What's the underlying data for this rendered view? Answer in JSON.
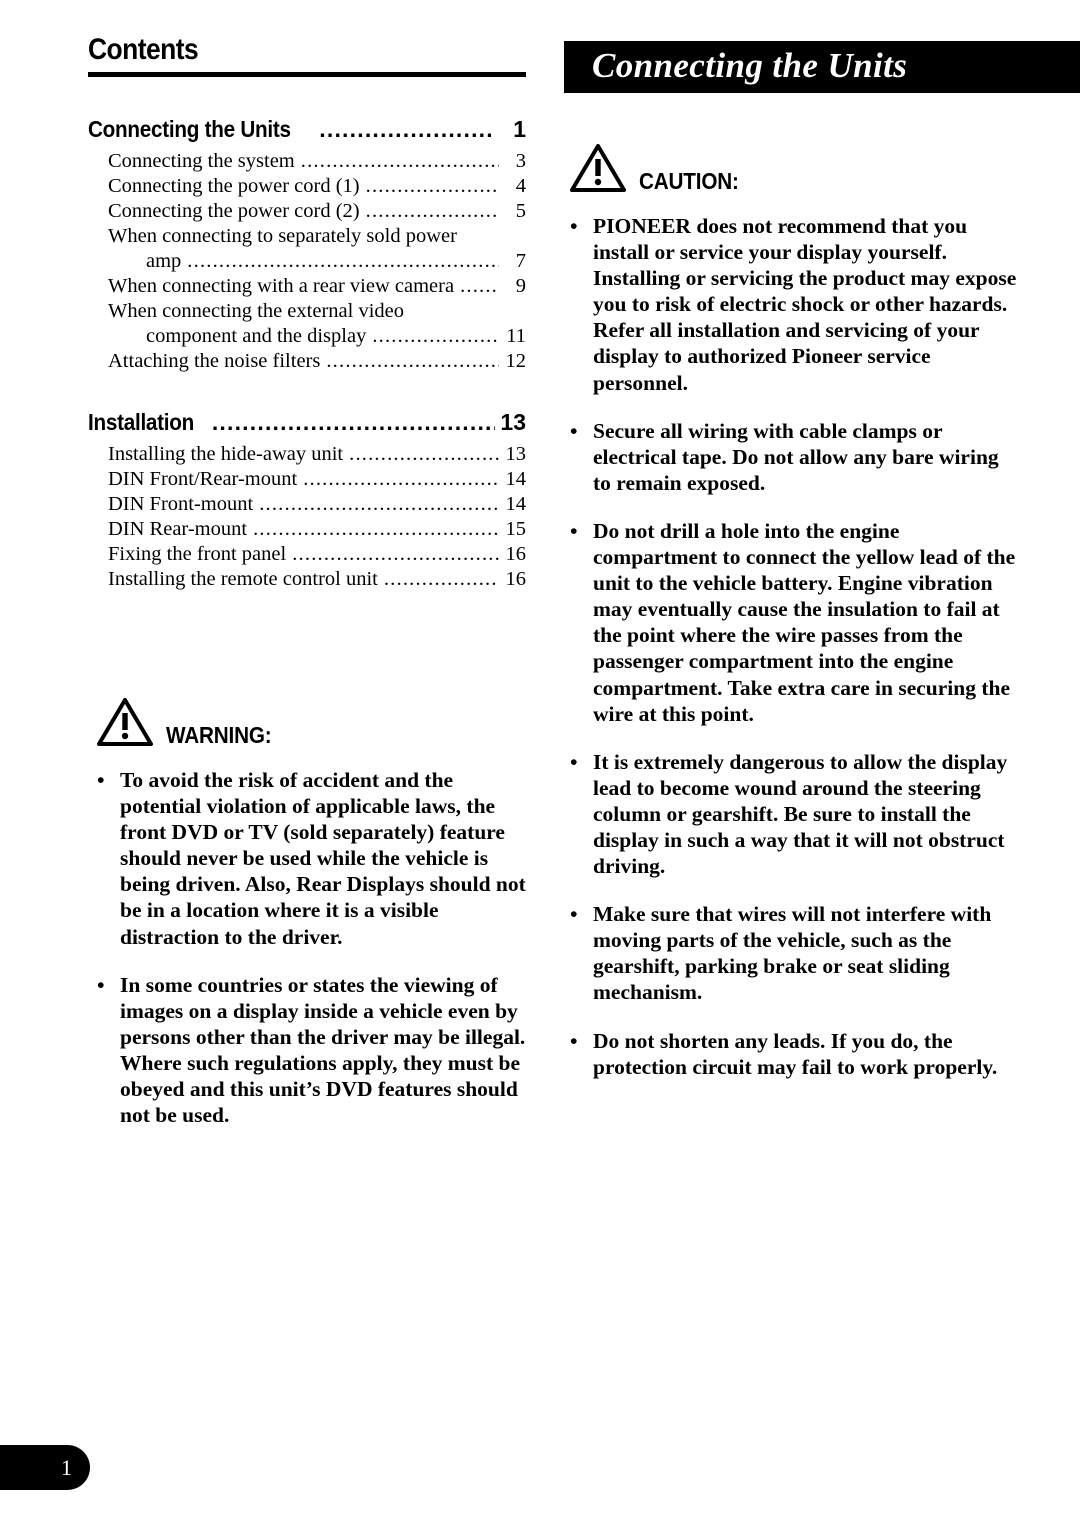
{
  "document": {
    "page_number": "1"
  },
  "left_column": {
    "heading": "Contents",
    "toc": [
      {
        "label": "Connecting the Units",
        "page": "1",
        "leader": "................................",
        "children": [
          {
            "label": "Connecting the system",
            "page": "3",
            "leader": ".....................................",
            "indent": 1
          },
          {
            "label": "Connecting the power cord (1)",
            "page": "4",
            "leader": "..........................",
            "indent": 1
          },
          {
            "label": "Connecting the power cord (2)",
            "page": "5",
            "leader": "..........................",
            "indent": 1
          },
          {
            "label": "When connecting to separately sold power",
            "page": "",
            "leader": "",
            "indent": 1,
            "continuation": true
          },
          {
            "label": "amp",
            "page": "7",
            "leader": "............................................................",
            "indent": 2
          },
          {
            "label": "When connecting with a rear view camera",
            "page": "9",
            "leader": "......",
            "indent": 1
          },
          {
            "label": "When connecting the external video",
            "page": "",
            "leader": "",
            "indent": 1,
            "continuation": true
          },
          {
            "label": "component and the display",
            "page": "11",
            "leader": ".......................",
            "indent": 2
          },
          {
            "label": "Attaching the noise filters",
            "page": "12",
            "leader": "..............................",
            "indent": 1
          }
        ]
      },
      {
        "label": "Installation",
        "page": "13",
        "leader": "................................................",
        "children": [
          {
            "label": "Installing the hide-away unit",
            "page": "13",
            "leader": "..........................",
            "indent": 1
          },
          {
            "label": "DIN Front/Rear-mount",
            "page": "14",
            "leader": "....................................",
            "indent": 1
          },
          {
            "label": "DIN Front-mount",
            "page": "14",
            "leader": ".........................................",
            "indent": 1
          },
          {
            "label": "DIN Rear-mount",
            "page": "15",
            "leader": ".............................................",
            "indent": 1
          },
          {
            "label": "Fixing the front panel",
            "page": "16",
            "leader": ".....................................",
            "indent": 1
          },
          {
            "label": "Installing the remote control unit",
            "page": "16",
            "leader": "...................",
            "indent": 1
          }
        ]
      }
    ],
    "warning": {
      "icon": "warning-triangle-icon",
      "title": "WARNING:",
      "bullet_marker": "•",
      "items": [
        "To avoid the risk of accident and the potential violation of applicable laws, the front DVD or TV (sold separately) feature should never be used while the vehicle is being driven. Also, Rear Displays should not be in a location where it is a visible distraction to the driver.",
        "In some countries or states the viewing of images on a display inside a vehicle even by persons other than the driver may be illegal. Where such regulations apply, they must be obeyed and this unit’s DVD features should not be used."
      ]
    }
  },
  "right_column": {
    "banner_title": "Connecting the Units",
    "banner_background": "#000000",
    "banner_text_color": "#ffffff",
    "caution": {
      "icon": "warning-triangle-icon",
      "title": "CAUTION:",
      "bullet_marker": "•",
      "items": [
        "PIONEER does not recommend that you install or service your display yourself. Installing or servicing the product may expose you to risk of electric shock or other hazards. Refer all installation and servicing of your display to authorized Pioneer service personnel.",
        "Secure all wiring with cable clamps or electrical tape. Do not allow any bare wiring to remain exposed.",
        "Do not drill a hole into the engine compartment to connect the yellow lead of the unit to the vehicle battery. Engine vibration may eventually cause the insulation to fail at the point where the wire passes from the passenger compartment into the engine compartment. Take extra care in securing the wire at this point.",
        "It is extremely dangerous to allow the display lead to become wound around the steering column or gearshift. Be sure to install the display in such a way that it will not obstruct driving.",
        "Make sure that wires will not interfere with moving parts of the vehicle, such as the gearshift, parking brake or seat sliding mechanism.",
        "Do not shorten any leads. If you do, the protection circuit may fail to work properly."
      ]
    }
  }
}
